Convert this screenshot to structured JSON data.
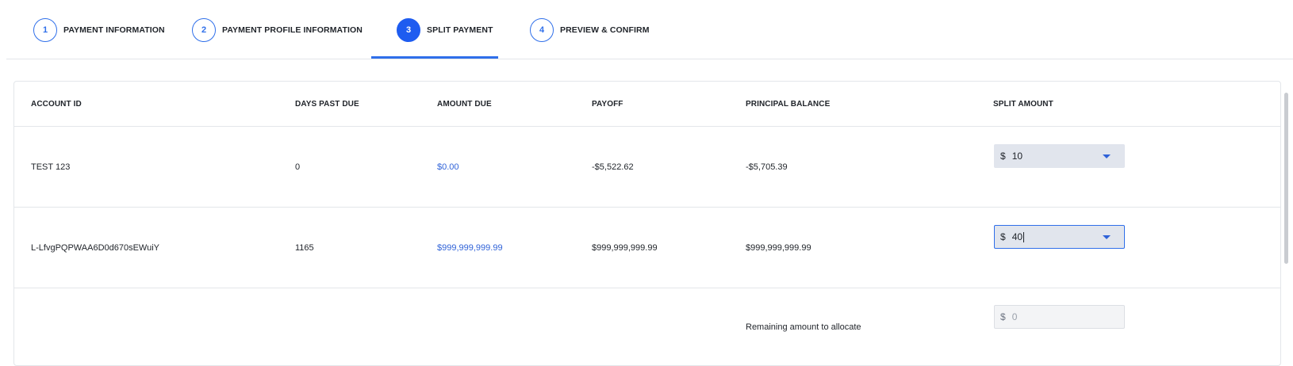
{
  "stepper": {
    "steps": [
      {
        "number": "1",
        "label": "PAYMENT INFORMATION"
      },
      {
        "number": "2",
        "label": "PAYMENT PROFILE INFORMATION"
      },
      {
        "number": "3",
        "label": "SPLIT PAYMENT"
      },
      {
        "number": "4",
        "label": "PREVIEW & CONFIRM"
      }
    ],
    "active_step": 3
  },
  "table": {
    "headers": [
      "ACCOUNT ID",
      "DAYS PAST DUE",
      "AMOUNT DUE",
      "PAYOFF",
      "PRINCIPAL BALANCE",
      "SPLIT AMOUNT"
    ],
    "rows": [
      {
        "account_id": "TEST 123",
        "days_past_due": "0",
        "amount_due": "$0.00",
        "payoff": "-$5,522.62",
        "principal_balance": "-$5,705.39",
        "split_currency": "$",
        "split_amount": "10"
      },
      {
        "account_id": "L-LfvgPQPWAA6D0d670sEWuiY",
        "days_past_due": "1165",
        "amount_due": "$999,999,999.99",
        "payoff": "$999,999,999.99",
        "principal_balance": "$999,999,999.99",
        "split_currency": "$",
        "split_amount": "40"
      }
    ],
    "remaining": {
      "label": "Remaining amount to allocate",
      "currency": "$",
      "value": "0"
    }
  },
  "colors": {
    "accent": "#2f6fea",
    "link": "#2f62d8",
    "border": "#e3e6ea"
  }
}
